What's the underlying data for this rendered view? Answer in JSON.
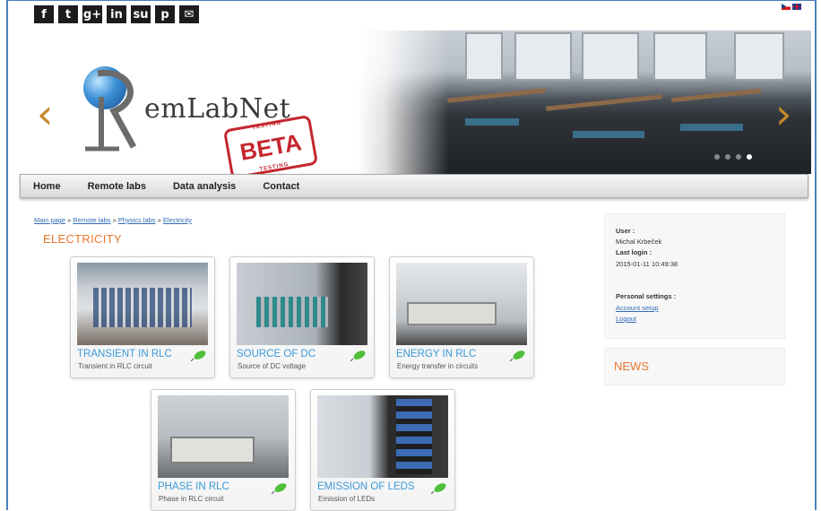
{
  "social": {
    "icons": [
      {
        "name": "facebook-icon",
        "glyph": "f"
      },
      {
        "name": "twitter-icon",
        "glyph": "t"
      },
      {
        "name": "google-plus-icon",
        "glyph": "g+"
      },
      {
        "name": "linkedin-icon",
        "glyph": "in"
      },
      {
        "name": "stumbleupon-icon",
        "glyph": "su"
      },
      {
        "name": "pinterest-icon",
        "glyph": "p"
      },
      {
        "name": "email-icon",
        "glyph": "✉"
      }
    ]
  },
  "languages": [
    "cz",
    "en"
  ],
  "hero": {
    "brand": "emLabNet",
    "beta": "BETA",
    "testing": "TESTING",
    "prev_arrow": "‹",
    "next_arrow": "›",
    "slides": 4,
    "active_slide": 3
  },
  "nav": {
    "items": [
      "Home",
      "Remote labs",
      "Data analysis",
      "Contact"
    ]
  },
  "breadcrumb": {
    "items": [
      "Main page",
      "Remote labs",
      "Physics labs",
      "Electricity"
    ],
    "separator": "»"
  },
  "page_title": "ELECTRICITY",
  "labs": [
    {
      "title": "TRANSIENT IN RLC",
      "subtitle": "Transient in RLC circuit"
    },
    {
      "title": "SOURCE OF DC",
      "subtitle": "Source of DC voltage"
    },
    {
      "title": "ENERGY IN RLC",
      "subtitle": "Energy transfer in circuits"
    },
    {
      "title": "PHASE IN RLC",
      "subtitle": "Phase in RLC circuit"
    },
    {
      "title": "EMISSION OF LEDS",
      "subtitle": "Emission of LEDs"
    }
  ],
  "user_panel": {
    "user_label": "User :",
    "user_name": "Michal Krbeček",
    "last_login_label": "Last login :",
    "last_login": "2015-01-11 10:49:38",
    "settings_label": "Personal settings :",
    "account_setup": "Account setup",
    "logout": "Logout"
  },
  "news": {
    "title": "NEWS"
  },
  "colors": {
    "accent_orange": "#e8772e",
    "link_blue": "#2f6bb8",
    "card_title_blue": "#3a9ad9",
    "frame_blue": "#4a7fb8"
  }
}
